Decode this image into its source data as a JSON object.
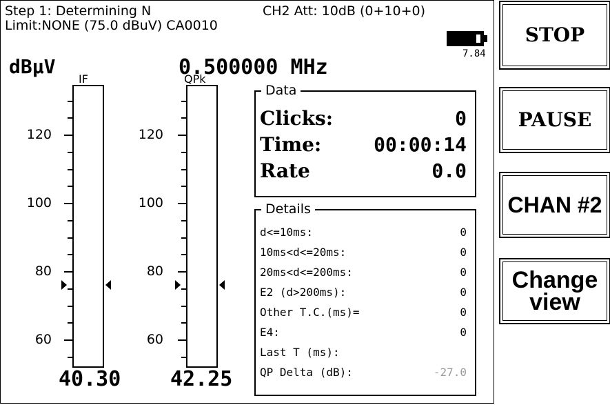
{
  "header": {
    "step": "Step 1: Determining N",
    "attenuation": "CH2 Att: 10dB (0+10+0)",
    "limit": "Limit:NONE (75.0 dBuV) CA0010",
    "battery_voltage": "7.84",
    "unit": "dBµV",
    "frequency": "0.500000 MHz"
  },
  "gauges": [
    {
      "label": "IF",
      "value": "40.30",
      "ticks": [
        "120",
        "100",
        "80",
        "60"
      ],
      "marker_level": 76
    },
    {
      "label": "QPk",
      "value": "42.25",
      "ticks": [
        "120",
        "100",
        "80",
        "60"
      ],
      "marker_level": 76
    }
  ],
  "data_panel": {
    "title": "Data",
    "clicks_label": "Clicks:",
    "clicks_value": "0",
    "time_label": "Time:",
    "time_value": "00:00:14",
    "rate_label": "Rate",
    "rate_value": "0.0"
  },
  "details_panel": {
    "title": "Details",
    "rows": [
      {
        "label": "d<=10ms:",
        "value": "0"
      },
      {
        "label": "10ms<d<=20ms:",
        "value": "0"
      },
      {
        "label": "20ms<d<=200ms:",
        "value": "0"
      },
      {
        "label": "E2 (d>200ms):",
        "value": "0"
      },
      {
        "label": "Other T.C.(ms)=",
        "value": "0"
      },
      {
        "label": "E4:",
        "value": "0"
      },
      {
        "label": "Last T (ms):",
        "value": ""
      },
      {
        "label": "QP Delta (dB):",
        "value": "-27.0"
      }
    ]
  },
  "buttons": {
    "stop": "STOP",
    "pause": "PAUSE",
    "chan": "CHAN #2",
    "change_line1": "Change",
    "change_line2": "view"
  }
}
